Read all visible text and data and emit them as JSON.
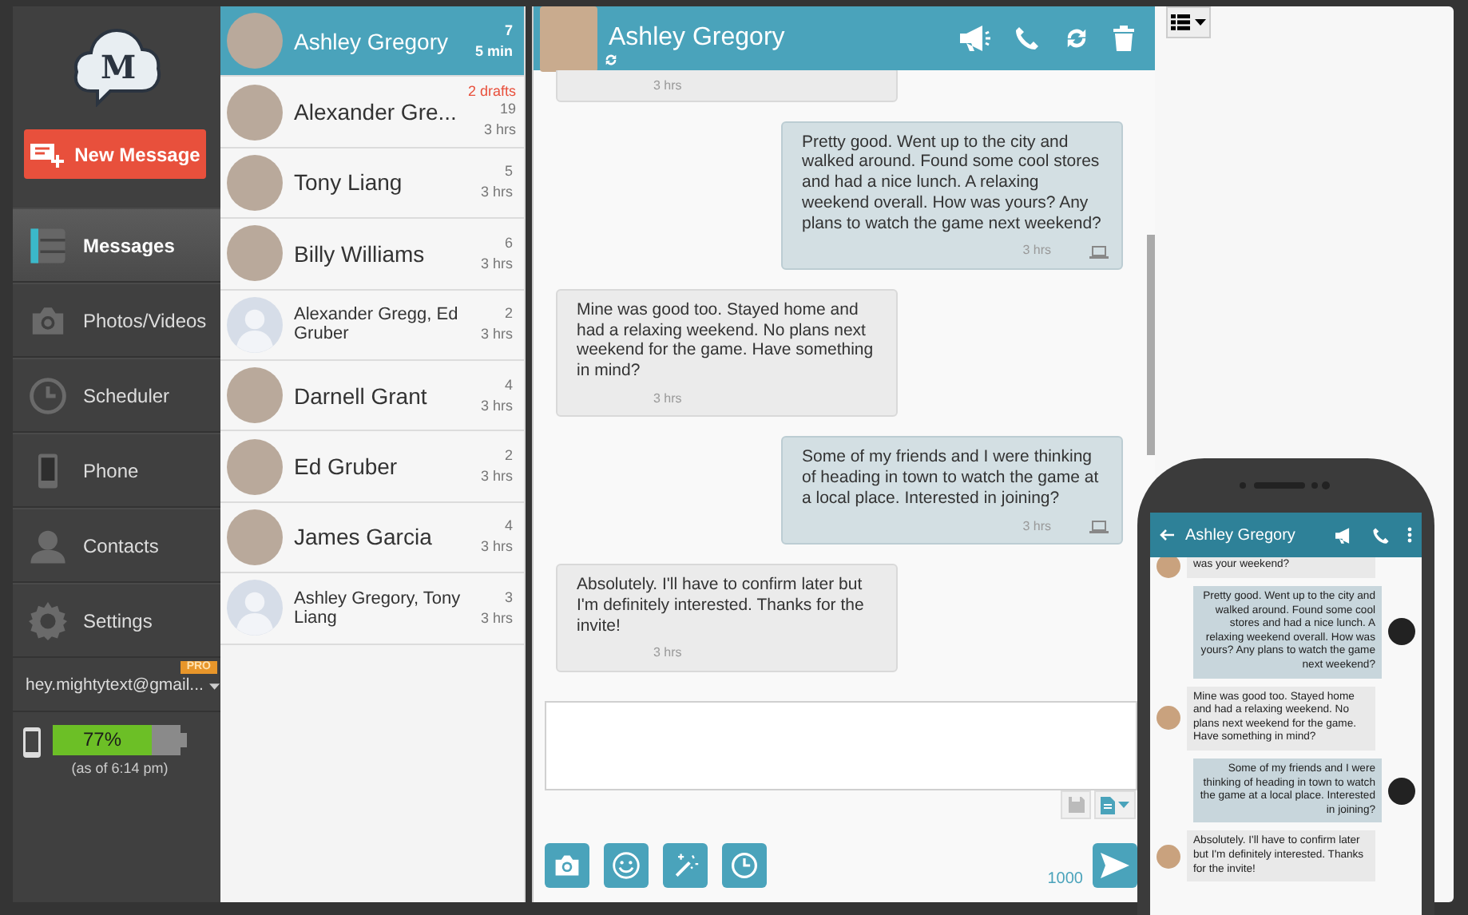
{
  "sidebar": {
    "logo": "M",
    "new_message": "New Message",
    "nav": [
      {
        "label": "Messages",
        "selected": true
      },
      {
        "label": "Photos/Videos",
        "selected": false
      },
      {
        "label": "Scheduler",
        "selected": false
      },
      {
        "label": "Phone",
        "selected": false
      },
      {
        "label": "Contacts",
        "selected": false
      },
      {
        "label": "Settings",
        "selected": false
      }
    ],
    "account": {
      "email": "hey.mightytext@gmail...",
      "badge": "PRO"
    },
    "battery": {
      "reading": "77%",
      "level": 0.77,
      "note": "(as of 6:14 pm)"
    }
  },
  "conversations": [
    {
      "name": "Ashley Gregory",
      "kind": "person",
      "count": "7",
      "time": "5 min",
      "selected": true
    },
    {
      "name": "Alexander Gre...",
      "kind": "person",
      "drafts": "2 drafts",
      "count": "19",
      "time": "3 hrs",
      "selected": false
    },
    {
      "name": "Tony Liang",
      "kind": "person",
      "count": "5",
      "time": "3 hrs",
      "selected": false
    },
    {
      "name": "Billy Williams",
      "kind": "person",
      "count": "6",
      "time": "3 hrs",
      "selected": false
    },
    {
      "name": "Alexander Gregg, Ed Gruber",
      "kind": "group",
      "count": "2",
      "time": "3 hrs",
      "selected": false
    },
    {
      "name": "Darnell Grant",
      "kind": "person",
      "count": "4",
      "time": "3 hrs",
      "selected": false
    },
    {
      "name": "Ed Gruber",
      "kind": "person",
      "count": "2",
      "time": "3 hrs",
      "selected": false
    },
    {
      "name": "James Garcia",
      "kind": "person",
      "count": "4",
      "time": "3 hrs",
      "selected": false
    },
    {
      "name": "Ashley Gregory, Tony Liang",
      "kind": "group",
      "count": "3",
      "time": "3 hrs",
      "selected": false
    }
  ],
  "chat": {
    "title": "Ashley Gregory",
    "messages": [
      {
        "kind": "in",
        "time": "3 hrs"
      },
      {
        "kind": "out",
        "text": "Pretty good. Went up to the city and walked around. Found some cool stores and had a nice lunch. A relaxing weekend overall. How was yours? Any plans to watch the game next weekend?",
        "time": "3 hrs"
      },
      {
        "kind": "in",
        "text": "Mine was good too.  Stayed home and had a relaxing weekend.  No plans next weekend for the game.  Have something in mind?",
        "time": "3 hrs"
      },
      {
        "kind": "out",
        "text": "Some of my friends and I were thinking of heading in town to watch the game at a local place. Interested in joining?",
        "time": "3 hrs"
      },
      {
        "kind": "in",
        "text": "Absolutely.  I'll have to confirm later but I'm definitely interested.  Thanks for the invite!",
        "time": "3 hrs"
      }
    ],
    "counter": "1000"
  },
  "phone": {
    "title": "Ashley Gregory",
    "messages": [
      {
        "kind": "in",
        "text": "was your weekend?"
      },
      {
        "kind": "out",
        "text": "Pretty good. Went up to the city and walked around. Found some cool stores and had a nice lunch. A relaxing weekend overall. How was yours? Any plans to watch the game next weekend?"
      },
      {
        "kind": "in",
        "text": "Mine was good too.  Stayed home and had a relaxing weekend.  No plans next weekend for the game.  Have something in mind?"
      },
      {
        "kind": "out",
        "text": "Some of my friends and I were thinking of heading in town to watch the game at a local place. Interested in joining?"
      },
      {
        "kind": "in",
        "text": "Absolutely.  I'll have to confirm later but I'm definitely interested.  Thanks for the invite!"
      }
    ]
  }
}
